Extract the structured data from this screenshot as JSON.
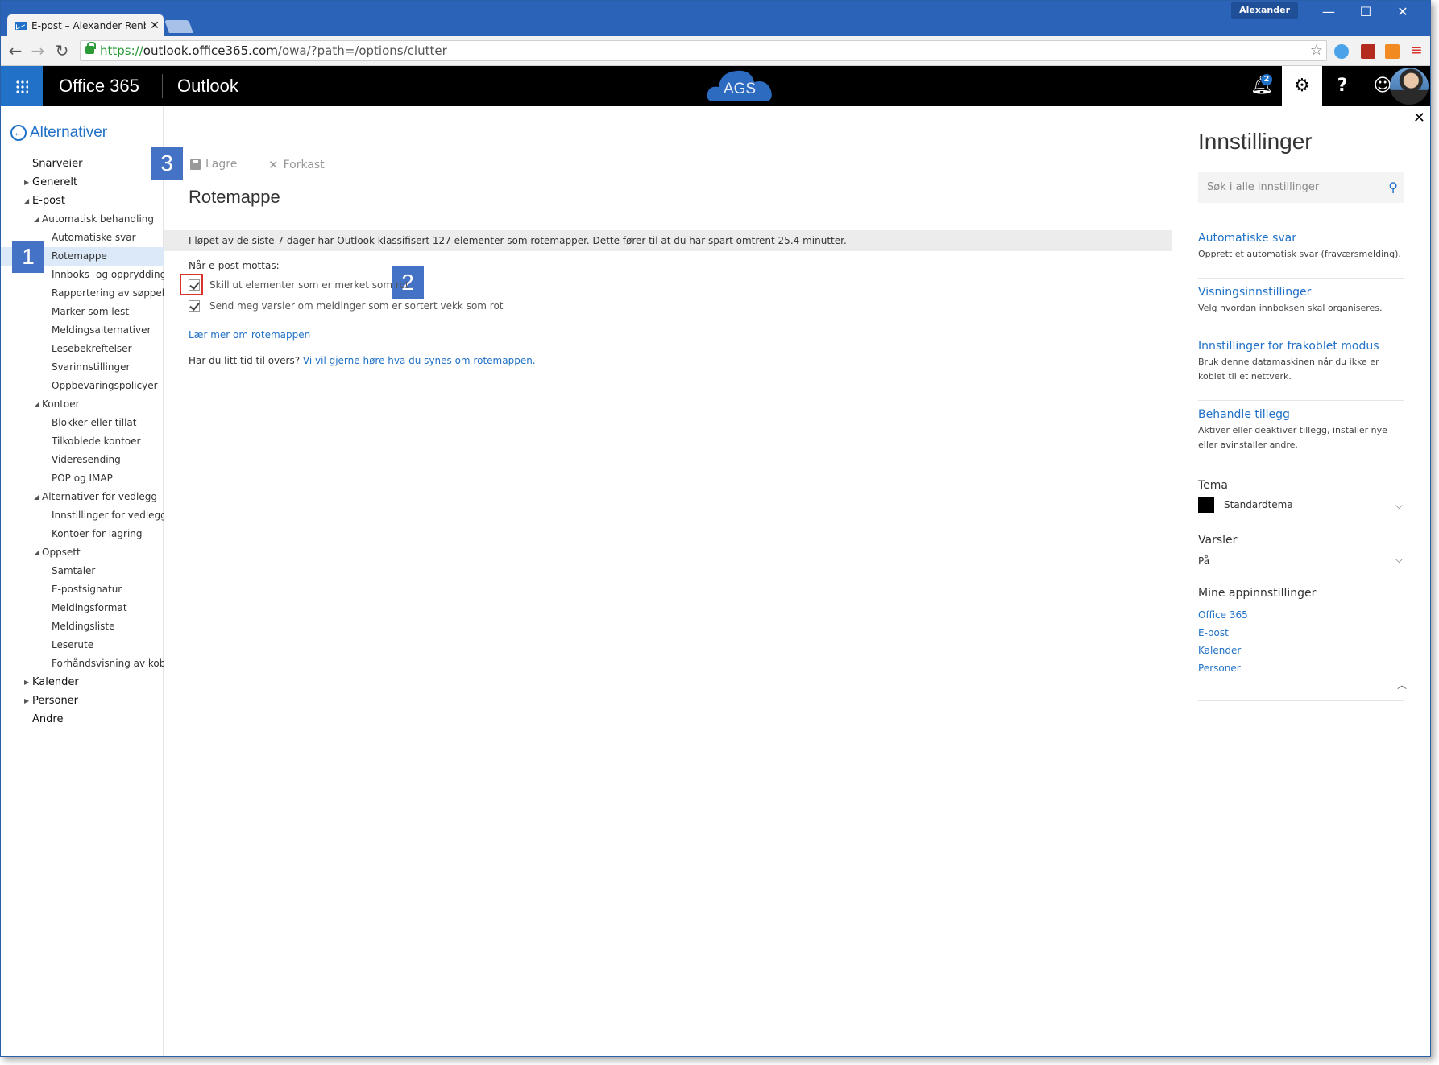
{
  "browser": {
    "tab_title": "E-post – Alexander Renbe",
    "tab_close": "✕",
    "user_badge": "Alexander",
    "url_https": "https://",
    "url_host": "outlook.office365.com",
    "url_path": "/owa/?path=/options/clutter",
    "icons": [
      "back-icon",
      "forward-icon",
      "reload-icon",
      "lock-icon",
      "star-icon"
    ]
  },
  "suite": {
    "office_label": "Office 365",
    "app_label": "Outlook",
    "cloud_label": "AGS",
    "notification_count": "2",
    "help_label": "?"
  },
  "leftnav": {
    "back_label": "Alternativer",
    "items": [
      {
        "label": "Snarveier",
        "level": 0,
        "arrow": ""
      },
      {
        "label": "Generelt",
        "level": 0,
        "arrow": "▶"
      },
      {
        "label": "E-post",
        "level": 0,
        "arrow": "◢"
      },
      {
        "label": "Automatisk behandling",
        "level": 1,
        "arrow": "◢"
      },
      {
        "label": "Automatiske svar",
        "level": 2,
        "arrow": ""
      },
      {
        "label": "Rotemappe",
        "level": 2,
        "arrow": "",
        "selected": true
      },
      {
        "label": "Innboks- og oppryddingsregler",
        "level": 2,
        "arrow": ""
      },
      {
        "label": "Rapportering av søppelpost",
        "level": 2,
        "arrow": ""
      },
      {
        "label": "Marker som lest",
        "level": 2,
        "arrow": ""
      },
      {
        "label": "Meldingsalternativer",
        "level": 2,
        "arrow": ""
      },
      {
        "label": "Lesebekreftelser",
        "level": 2,
        "arrow": ""
      },
      {
        "label": "Svarinnstillinger",
        "level": 2,
        "arrow": ""
      },
      {
        "label": "Oppbevaringspolicyer",
        "level": 2,
        "arrow": ""
      },
      {
        "label": "Kontoer",
        "level": 1,
        "arrow": "◢"
      },
      {
        "label": "Blokker eller tillat",
        "level": 2,
        "arrow": ""
      },
      {
        "label": "Tilkoblede kontoer",
        "level": 2,
        "arrow": ""
      },
      {
        "label": "Videresending",
        "level": 2,
        "arrow": ""
      },
      {
        "label": "POP og IMAP",
        "level": 2,
        "arrow": ""
      },
      {
        "label": "Alternativer for vedlegg",
        "level": 1,
        "arrow": "◢"
      },
      {
        "label": "Innstillinger for vedlegg",
        "level": 2,
        "arrow": ""
      },
      {
        "label": "Kontoer for lagring",
        "level": 2,
        "arrow": ""
      },
      {
        "label": "Oppsett",
        "level": 1,
        "arrow": "◢"
      },
      {
        "label": "Samtaler",
        "level": 2,
        "arrow": ""
      },
      {
        "label": "E-postsignatur",
        "level": 2,
        "arrow": ""
      },
      {
        "label": "Meldingsformat",
        "level": 2,
        "arrow": ""
      },
      {
        "label": "Meldingsliste",
        "level": 2,
        "arrow": ""
      },
      {
        "label": "Leserute",
        "level": 2,
        "arrow": ""
      },
      {
        "label": "Forhåndsvisning av koblinger",
        "level": 2,
        "arrow": ""
      },
      {
        "label": "Kalender",
        "level": 0,
        "arrow": "▶"
      },
      {
        "label": "Personer",
        "level": 0,
        "arrow": "▶"
      },
      {
        "label": "Andre",
        "level": 0,
        "arrow": ""
      }
    ]
  },
  "callouts": {
    "one": "1",
    "two": "2",
    "three": "3"
  },
  "main": {
    "save_label": "Lagre",
    "discard_label": "Forkast",
    "page_title": "Rotemappe",
    "info_text": "I løpet av de siste 7 dager har Outlook klassifisert 127 elementer som rotemapper. Dette fører til at du har spart omtrent 25.4 minutter.",
    "when_label": "Når e-post mottas:",
    "checkbox1_label": "Skill ut elementer som er merket som rot",
    "checkbox2_label": "Send meg varsler om meldinger som er sortert vekk som rot",
    "learn_more": "Lær mer om rotemappen",
    "feedback_prefix": "Har du litt tid til overs?",
    "feedback_link": "Vi vil gjerne høre hva du synes om rotemappen."
  },
  "settings": {
    "title": "Innstillinger",
    "search_placeholder": "Søk i alle innstillinger",
    "blocks": [
      {
        "title": "Automatiske svar",
        "desc": "Opprett et automatisk svar (fraværsmelding)."
      },
      {
        "title": "Visningsinnstillinger",
        "desc": "Velg hvordan innboksen skal organiseres."
      },
      {
        "title": "Innstillinger for frakoblet modus",
        "desc": "Bruk denne datamaskinen når du ikke er koblet til et nettverk."
      },
      {
        "title": "Behandle tillegg",
        "desc": "Aktiver eller deaktiver tillegg, installer nye eller avinstaller andre."
      }
    ],
    "theme_heading": "Tema",
    "theme_value": "Standardtema",
    "notifications_heading": "Varsler",
    "notifications_value": "På",
    "app_settings_heading": "Mine appinnstillinger",
    "app_links": [
      "Office 365",
      "E-post",
      "Kalender",
      "Personer"
    ]
  }
}
